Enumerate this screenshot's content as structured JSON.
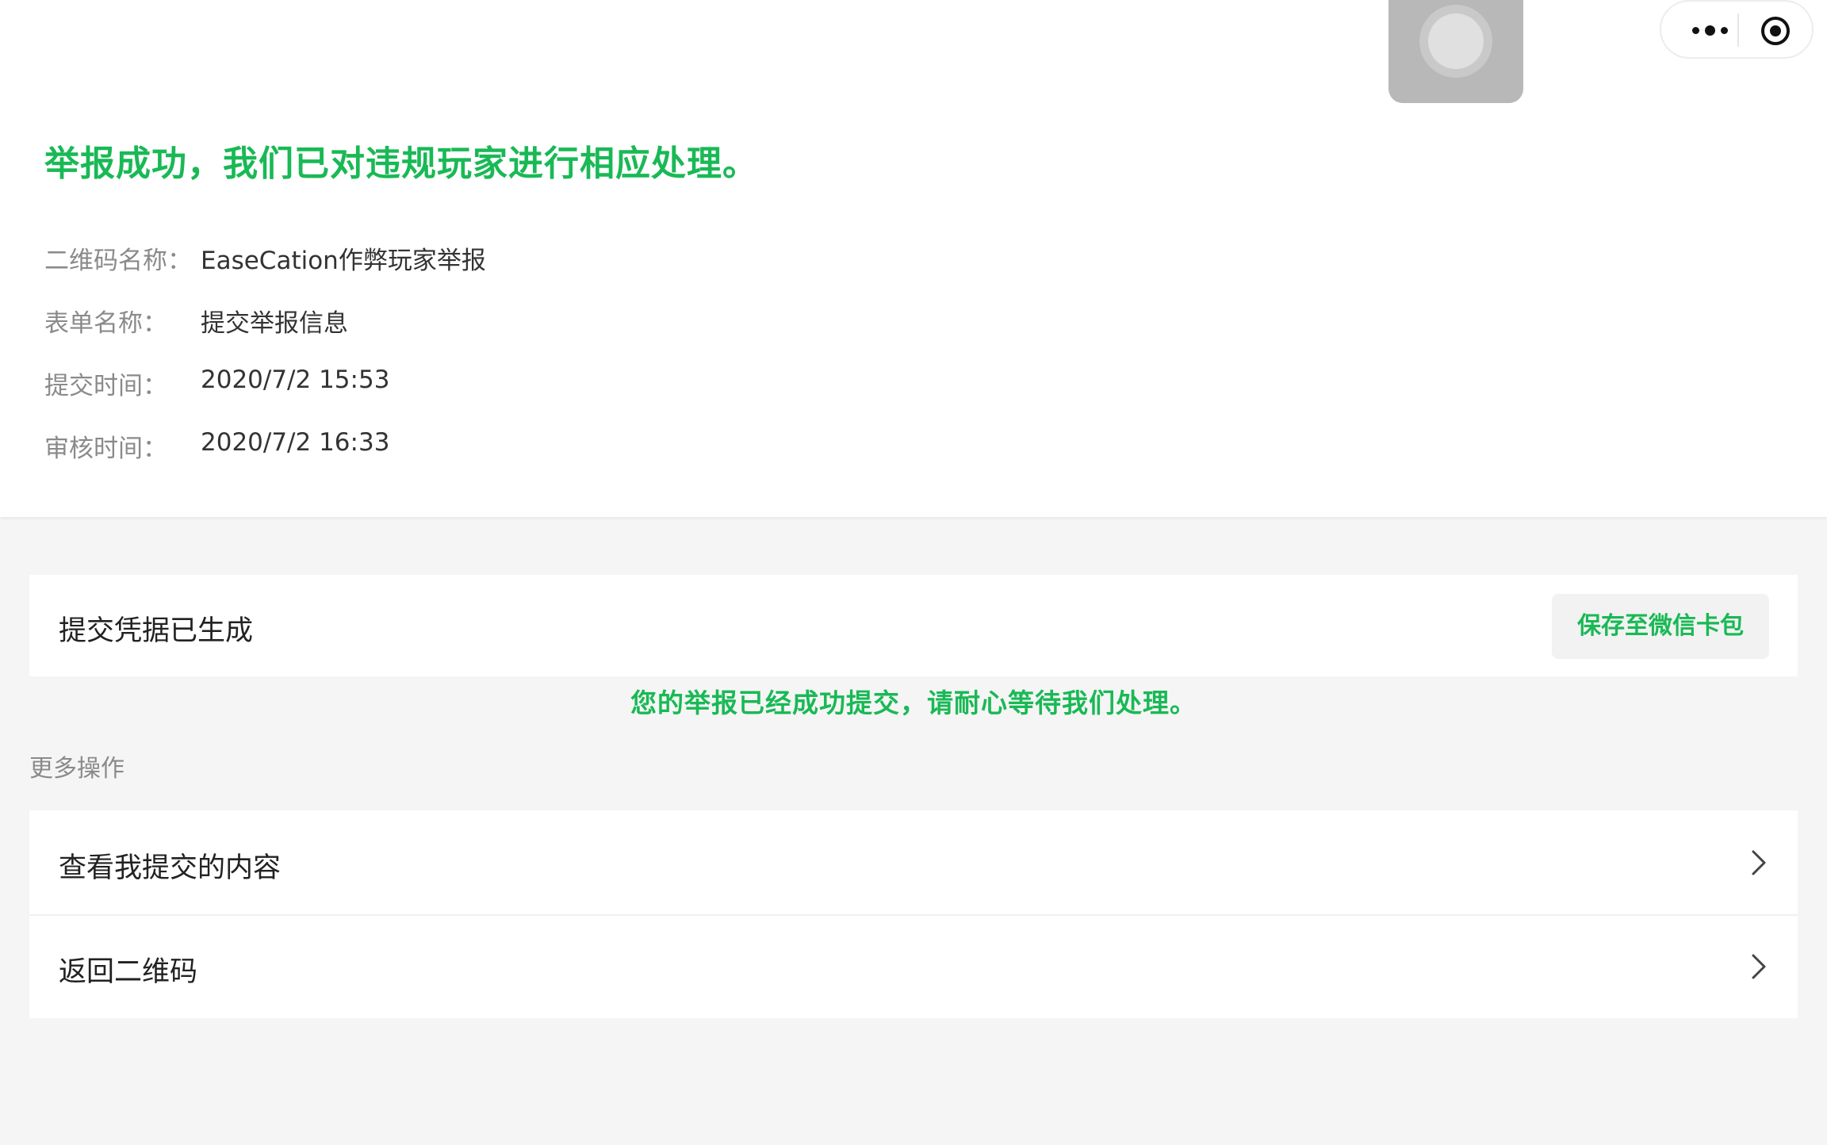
{
  "header": {
    "title": "举报成功，我们已对违规玩家进行相应处理。"
  },
  "info": {
    "rows": [
      {
        "label": "二维码名称：",
        "value": "EaseCation作弊玩家举报"
      },
      {
        "label": "表单名称：",
        "value": "提交举报信息"
      },
      {
        "label": "提交时间：",
        "value": "2020/7/2 15:53"
      },
      {
        "label": "审核时间：",
        "value": "2020/7/2 16:33"
      }
    ]
  },
  "receipt": {
    "text": "提交凭据已生成",
    "save_label": "保存至微信卡包"
  },
  "notice": "您的举报已经成功提交，请耐心等待我们处理。",
  "more": {
    "section_label": "更多操作",
    "items": [
      {
        "label": "查看我提交的内容"
      },
      {
        "label": "返回二维码"
      }
    ]
  },
  "colors": {
    "accent": "#19b955",
    "background": "#f5f5f5"
  },
  "icons": [
    "more-icon",
    "close-target-icon",
    "chevron-right-icon"
  ]
}
